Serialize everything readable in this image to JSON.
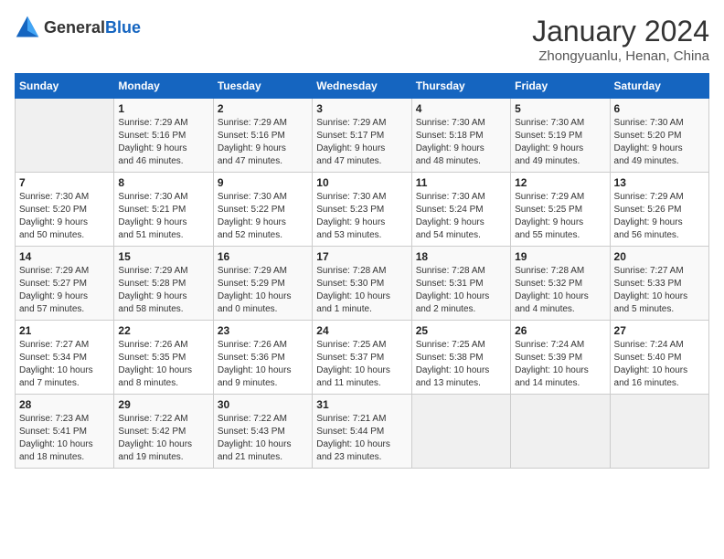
{
  "header": {
    "logo_general": "General",
    "logo_blue": "Blue",
    "month_title": "January 2024",
    "subtitle": "Zhongyuanlu, Henan, China"
  },
  "weekdays": [
    "Sunday",
    "Monday",
    "Tuesday",
    "Wednesday",
    "Thursday",
    "Friday",
    "Saturday"
  ],
  "weeks": [
    [
      {
        "day": "",
        "info": ""
      },
      {
        "day": "1",
        "info": "Sunrise: 7:29 AM\nSunset: 5:16 PM\nDaylight: 9 hours\nand 46 minutes."
      },
      {
        "day": "2",
        "info": "Sunrise: 7:29 AM\nSunset: 5:16 PM\nDaylight: 9 hours\nand 47 minutes."
      },
      {
        "day": "3",
        "info": "Sunrise: 7:29 AM\nSunset: 5:17 PM\nDaylight: 9 hours\nand 47 minutes."
      },
      {
        "day": "4",
        "info": "Sunrise: 7:30 AM\nSunset: 5:18 PM\nDaylight: 9 hours\nand 48 minutes."
      },
      {
        "day": "5",
        "info": "Sunrise: 7:30 AM\nSunset: 5:19 PM\nDaylight: 9 hours\nand 49 minutes."
      },
      {
        "day": "6",
        "info": "Sunrise: 7:30 AM\nSunset: 5:20 PM\nDaylight: 9 hours\nand 49 minutes."
      }
    ],
    [
      {
        "day": "7",
        "info": "Sunrise: 7:30 AM\nSunset: 5:20 PM\nDaylight: 9 hours\nand 50 minutes."
      },
      {
        "day": "8",
        "info": "Sunrise: 7:30 AM\nSunset: 5:21 PM\nDaylight: 9 hours\nand 51 minutes."
      },
      {
        "day": "9",
        "info": "Sunrise: 7:30 AM\nSunset: 5:22 PM\nDaylight: 9 hours\nand 52 minutes."
      },
      {
        "day": "10",
        "info": "Sunrise: 7:30 AM\nSunset: 5:23 PM\nDaylight: 9 hours\nand 53 minutes."
      },
      {
        "day": "11",
        "info": "Sunrise: 7:30 AM\nSunset: 5:24 PM\nDaylight: 9 hours\nand 54 minutes."
      },
      {
        "day": "12",
        "info": "Sunrise: 7:29 AM\nSunset: 5:25 PM\nDaylight: 9 hours\nand 55 minutes."
      },
      {
        "day": "13",
        "info": "Sunrise: 7:29 AM\nSunset: 5:26 PM\nDaylight: 9 hours\nand 56 minutes."
      }
    ],
    [
      {
        "day": "14",
        "info": "Sunrise: 7:29 AM\nSunset: 5:27 PM\nDaylight: 9 hours\nand 57 minutes."
      },
      {
        "day": "15",
        "info": "Sunrise: 7:29 AM\nSunset: 5:28 PM\nDaylight: 9 hours\nand 58 minutes."
      },
      {
        "day": "16",
        "info": "Sunrise: 7:29 AM\nSunset: 5:29 PM\nDaylight: 10 hours\nand 0 minutes."
      },
      {
        "day": "17",
        "info": "Sunrise: 7:28 AM\nSunset: 5:30 PM\nDaylight: 10 hours\nand 1 minute."
      },
      {
        "day": "18",
        "info": "Sunrise: 7:28 AM\nSunset: 5:31 PM\nDaylight: 10 hours\nand 2 minutes."
      },
      {
        "day": "19",
        "info": "Sunrise: 7:28 AM\nSunset: 5:32 PM\nDaylight: 10 hours\nand 4 minutes."
      },
      {
        "day": "20",
        "info": "Sunrise: 7:27 AM\nSunset: 5:33 PM\nDaylight: 10 hours\nand 5 minutes."
      }
    ],
    [
      {
        "day": "21",
        "info": "Sunrise: 7:27 AM\nSunset: 5:34 PM\nDaylight: 10 hours\nand 7 minutes."
      },
      {
        "day": "22",
        "info": "Sunrise: 7:26 AM\nSunset: 5:35 PM\nDaylight: 10 hours\nand 8 minutes."
      },
      {
        "day": "23",
        "info": "Sunrise: 7:26 AM\nSunset: 5:36 PM\nDaylight: 10 hours\nand 9 minutes."
      },
      {
        "day": "24",
        "info": "Sunrise: 7:25 AM\nSunset: 5:37 PM\nDaylight: 10 hours\nand 11 minutes."
      },
      {
        "day": "25",
        "info": "Sunrise: 7:25 AM\nSunset: 5:38 PM\nDaylight: 10 hours\nand 13 minutes."
      },
      {
        "day": "26",
        "info": "Sunrise: 7:24 AM\nSunset: 5:39 PM\nDaylight: 10 hours\nand 14 minutes."
      },
      {
        "day": "27",
        "info": "Sunrise: 7:24 AM\nSunset: 5:40 PM\nDaylight: 10 hours\nand 16 minutes."
      }
    ],
    [
      {
        "day": "28",
        "info": "Sunrise: 7:23 AM\nSunset: 5:41 PM\nDaylight: 10 hours\nand 18 minutes."
      },
      {
        "day": "29",
        "info": "Sunrise: 7:22 AM\nSunset: 5:42 PM\nDaylight: 10 hours\nand 19 minutes."
      },
      {
        "day": "30",
        "info": "Sunrise: 7:22 AM\nSunset: 5:43 PM\nDaylight: 10 hours\nand 21 minutes."
      },
      {
        "day": "31",
        "info": "Sunrise: 7:21 AM\nSunset: 5:44 PM\nDaylight: 10 hours\nand 23 minutes."
      },
      {
        "day": "",
        "info": ""
      },
      {
        "day": "",
        "info": ""
      },
      {
        "day": "",
        "info": ""
      }
    ]
  ]
}
